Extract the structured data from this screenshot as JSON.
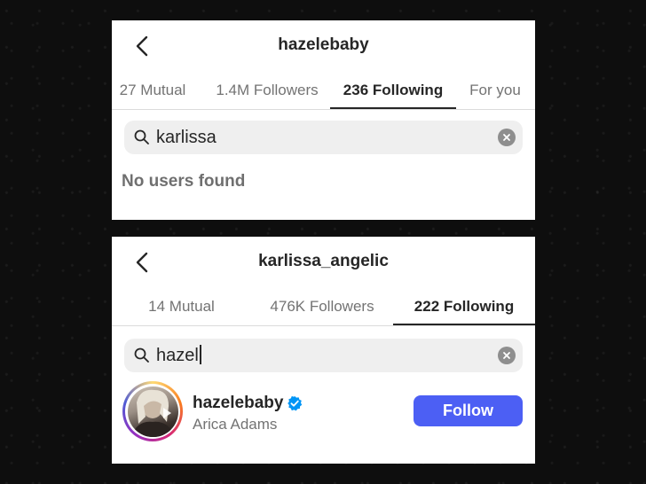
{
  "screen1": {
    "title": "hazelebaby",
    "tabs": [
      {
        "label": "27 Mutual"
      },
      {
        "label": "1.4M Followers"
      },
      {
        "label": "236 Following"
      },
      {
        "label": "For you"
      }
    ],
    "active_tab": "236 Following",
    "search": {
      "value": "karlissa"
    },
    "empty_message": "No users found"
  },
  "screen2": {
    "title": "karlissa_angelic",
    "tabs": [
      {
        "label": "14 Mutual"
      },
      {
        "label": "476K Followers"
      },
      {
        "label": "222 Following"
      }
    ],
    "active_tab": "222 Following",
    "search": {
      "value": "hazel"
    },
    "result": {
      "username": "hazelebaby",
      "full_name": "Arica Adams",
      "verified": true,
      "button_label": "Follow"
    }
  },
  "colors": {
    "follow_button": "#4c5ff4",
    "verified_badge": "#0095f6",
    "muted_text": "#737373"
  },
  "icons": [
    "back-chevron-icon",
    "search-icon",
    "clear-icon",
    "verified-badge-icon",
    "story-ring"
  ]
}
